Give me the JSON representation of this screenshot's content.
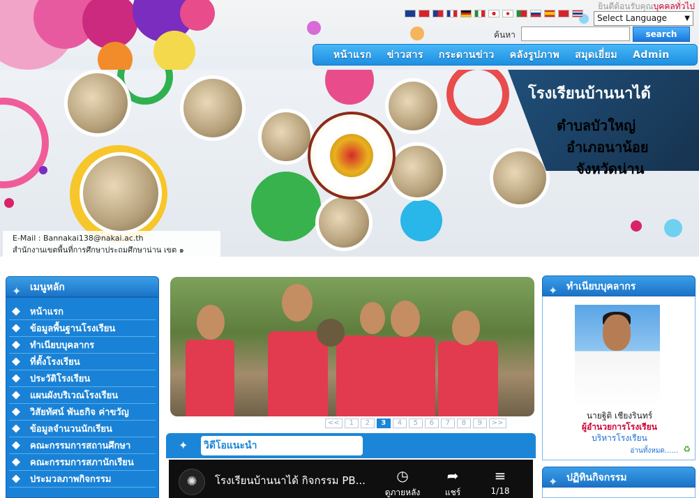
{
  "header": {
    "top_link_prefix": "ยินดีต้อนรับคุณ",
    "top_link_suffix": "บุคคลทั่วไป",
    "language_select_value": "Select Language",
    "search_label": "ค้นหา",
    "search_button": "search",
    "flags": [
      "gb",
      "cn",
      "tw",
      "fr",
      "de",
      "it",
      "jp",
      "kr",
      "pt",
      "ru",
      "es",
      "vn",
      "th"
    ],
    "nav": [
      "หน้าแรก",
      "ข่าวสาร",
      "กระดานข่าว",
      "คลังรูปภาพ",
      "สมุดเยี่ยม",
      "Admin"
    ]
  },
  "banner": {
    "school_name": "โรงเรียนบ้านนาได้",
    "tambon": "ตำบลบัวใหญ่",
    "amphoe": "อำเภอนาน้อย",
    "province": "จังหวัดน่าน",
    "email": "E-Mail : Bannakai138@nakai.ac.th",
    "office": "สำนักงานเขตพื้นที่การศึกษาประถมศึกษาน่าน เขต ๑"
  },
  "left_menu": {
    "title": "เมนูหลัก",
    "items": [
      "หน้าแรก",
      "ข้อมูลพื้นฐานโรงเรียน",
      "ทำเนียบบุคลากร",
      "ที่ตั้งโรงเรียน",
      "ประวัติโรงเรียน",
      "แผนผังบริเวณโรงเรียน",
      "วิสัยทัศน์ พันธกิจ ค่าขวัญ",
      "ข้อมูลจำนวนนักเรียน",
      "คณะกรรมการสถานศึกษา",
      "คณะกรรมการสภานักเรียน",
      "ประมวลภาพกิจกรรม"
    ]
  },
  "slider": {
    "pages": [
      "<<",
      "1",
      "2",
      "3",
      "4",
      "5",
      "6",
      "7",
      "8",
      "9",
      ">>"
    ],
    "active_page": "3"
  },
  "video": {
    "section_title": "วิดีโอแนะนำ",
    "title": "โรงเรียนบ้านนาได้ กิจกรรม PB...",
    "watch_later": "ดูภายหลัง",
    "share": "แชร์",
    "playlist_count": "1/18"
  },
  "staff": {
    "title": "ทำเนียบบุคลากร",
    "name": "นายฐิติ เชียงรินทร์",
    "position": "ผู้อำนวยการโรงเรียน",
    "department": "บริหารโรงเรียน",
    "read_all": "อ่านทั้งหมด......"
  },
  "calendar": {
    "title": "ปฏิทินกิจกรรม"
  },
  "colors": {
    "primary_blue": "#1b86d8",
    "accent_red": "#cc0033",
    "banner_panel": "#1f4f7a"
  }
}
